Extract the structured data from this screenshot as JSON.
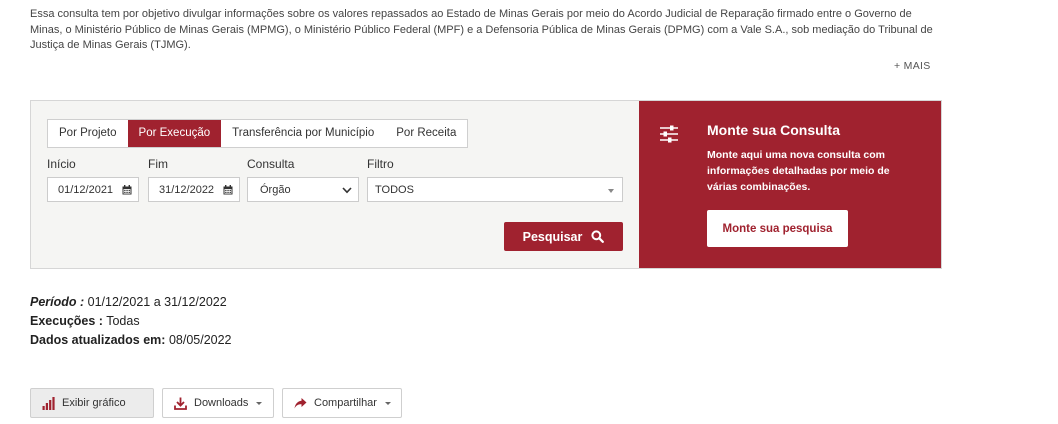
{
  "intro": {
    "text": "Essa consulta tem por objetivo divulgar informações sobre os valores repassados ao Estado de Minas Gerais por meio do Acordo Judicial de Reparação firmado entre o Governo de Minas, o Ministério Público de Minas Gerais (MPMG), o Ministério Público Federal (MPF) e a Defensoria Pública de Minas Gerais (DPMG) com a Vale S.A., sob mediação do Tribunal de Justiça de Minas Gerais (TJMG).",
    "more_label": "+ MAIS"
  },
  "tabs": [
    {
      "label": "Por Projeto",
      "active": false
    },
    {
      "label": "Por Execução",
      "active": true
    },
    {
      "label": "Transferência por Município",
      "active": false
    },
    {
      "label": "Por Receita",
      "active": false
    }
  ],
  "form": {
    "inicio_label": "Início",
    "inicio_value": "01/12/2021",
    "fim_label": "Fim",
    "fim_value": "31/12/2022",
    "consulta_label": "Consulta",
    "consulta_value": "Órgão",
    "filtro_label": "Filtro",
    "filtro_value": "TODOS",
    "search_button": "Pesquisar"
  },
  "custom_query": {
    "title": "Monte sua Consulta",
    "description": "Monte aqui uma nova consulta com informações detalhadas por meio de várias combinações.",
    "button": "Monte sua pesquisa"
  },
  "summary": {
    "periodo_label": "Período :",
    "periodo_value": "01/12/2021 a 31/12/2022",
    "execucoes_label": "Execuções :",
    "execucoes_value": "Todas",
    "atualizados_label": "Dados atualizados em:",
    "atualizados_value": "08/05/2022"
  },
  "actions": {
    "chart_label": "Exibir gráfico",
    "downloads_label": "Downloads",
    "share_label": "Compartilhar"
  },
  "colors": {
    "brand": "#a0222f",
    "panel_bg": "#f5f5f3"
  },
  "icons": [
    "calendar-icon",
    "chevron-down-icon",
    "search-icon",
    "sliders-icon",
    "bar-chart-icon",
    "download-icon",
    "share-icon"
  ]
}
